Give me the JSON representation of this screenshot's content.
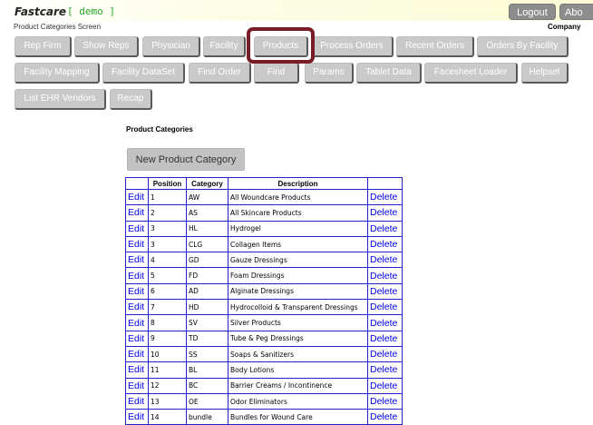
{
  "header": {
    "brand": "Fastcare",
    "brand_tag": "[ demo ]",
    "subtitle": "Product Categories Screen",
    "company_label": "Company",
    "logout_label": "Logout",
    "about_label": "Abo"
  },
  "nav": [
    "Rep Firm",
    "Show Reps",
    "Physician",
    "Facility",
    "Products",
    "Process Orders",
    "Recent Orders",
    "Orders By Facility",
    "Facility Mapping",
    "Facility DataSet",
    "Find Order",
    "Find",
    "Params",
    "Tablet Data",
    "Facesheet Loader",
    "Helpset",
    "List EHR Vendors",
    "Recap"
  ],
  "section_title": "Product Categories",
  "new_button_label": "New Product Category",
  "table": {
    "headers": [
      "",
      "Position",
      "Category",
      "Description",
      ""
    ],
    "edit_label": "Edit",
    "delete_label": "Delete",
    "rows": [
      {
        "position": "1",
        "category": "AW",
        "description": "All Woundcare Products"
      },
      {
        "position": "2",
        "category": "AS",
        "description": "All Skincare Products"
      },
      {
        "position": "3",
        "category": "HL",
        "description": "Hydrogel"
      },
      {
        "position": "3",
        "category": "CLG",
        "description": "Collagen Items"
      },
      {
        "position": "4",
        "category": "GD",
        "description": "Gauze Dressings"
      },
      {
        "position": "5",
        "category": "FD",
        "description": "Foam Dressings"
      },
      {
        "position": "6",
        "category": "AD",
        "description": "Alginate Dressings"
      },
      {
        "position": "7",
        "category": "HD",
        "description": "Hydrocolloid & Transparent Dressings"
      },
      {
        "position": "8",
        "category": "SV",
        "description": "Silver Products"
      },
      {
        "position": "9",
        "category": "TD",
        "description": "Tube & Peg Dressings"
      },
      {
        "position": "10",
        "category": "SS",
        "description": "Soaps & Sanitizers"
      },
      {
        "position": "11",
        "category": "BL",
        "description": "Body Lotions"
      },
      {
        "position": "12",
        "category": "BC",
        "description": "Barrier Creams / Incontinence"
      },
      {
        "position": "13",
        "category": "OE",
        "description": "Odor Eliminators"
      },
      {
        "position": "14",
        "category": "bundle",
        "description": "Bundles for Wound Care"
      }
    ]
  },
  "colors": {
    "highlight_border": "#7a1c28",
    "brand_tag": "#2aa52a",
    "link": "#0000ee"
  }
}
